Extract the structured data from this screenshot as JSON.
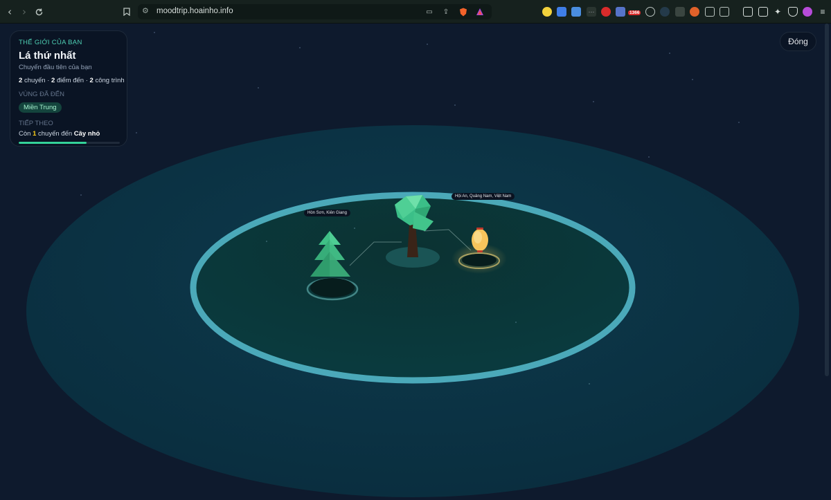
{
  "browser": {
    "url": "moodtrip.hoainho.info",
    "extension_badge": "1366"
  },
  "world_panel": {
    "eyebrow": "THẾ GIỚI CỦA BẠN",
    "title": "Lá thứ nhất",
    "subtitle": "Chuyến đầu tiên của bạn",
    "stats": {
      "trips": "2",
      "trips_label": "chuyến",
      "sep1": "·",
      "destinations": "2",
      "destinations_label": "điểm đến",
      "sep2": "·",
      "buildings": "2",
      "buildings_label": "công trình"
    },
    "regions_heading": "VÙNG ĐÃ ĐẾN",
    "regions": [
      "Miền Trung"
    ],
    "next_heading": "TIẾP THEO",
    "next": {
      "prefix": "Còn",
      "count": "1",
      "middle": "chuyến đến",
      "target": "Cây nhỏ",
      "progress_percent": 67
    }
  },
  "close_label": "Đóng",
  "locations": [
    {
      "label": "Hòn Sơn, Kiên Giang"
    },
    {
      "label": "Hội An, Quảng Nam, Việt Nam"
    }
  ],
  "colors": {
    "accent": "#4fd1b5",
    "progress": "#34d399",
    "ring": "#52b6c6",
    "outer_disc": "#0b3446",
    "inner_disc": "#0a3a3a",
    "lantern": "#f7c55c"
  },
  "icons": [
    "back-icon",
    "forward-icon",
    "reload-icon",
    "bookmark-icon",
    "site-settings-icon",
    "cast-icon",
    "share-icon",
    "brave-shields-icon",
    "brave-rewards-icon"
  ]
}
